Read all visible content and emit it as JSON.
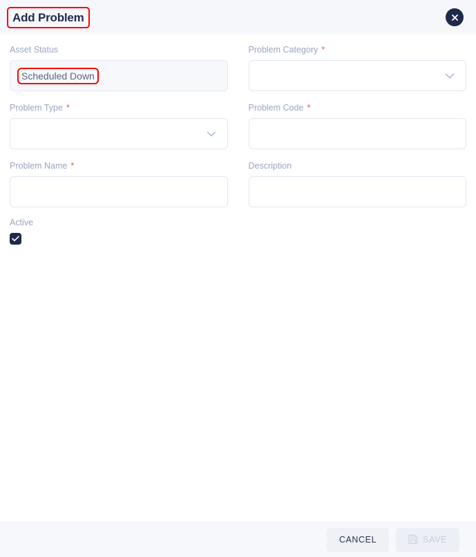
{
  "dialog": {
    "title": "Add Problem",
    "close_icon": "close-icon"
  },
  "form": {
    "fields": [
      {
        "label": "Asset Status",
        "required": false,
        "type": "text-disabled",
        "value": "Scheduled Down",
        "placeholder": "",
        "annotated": true
      },
      {
        "label": "Problem Category",
        "required": true,
        "type": "select",
        "value": "",
        "placeholder": "",
        "annotated": false
      },
      {
        "label": "Problem Type",
        "required": true,
        "type": "select",
        "value": "",
        "placeholder": "",
        "annotated": false
      },
      {
        "label": "Problem Code",
        "required": true,
        "type": "text",
        "value": "",
        "placeholder": "",
        "annotated": false
      },
      {
        "label": "Problem Name",
        "required": true,
        "type": "text",
        "value": "",
        "placeholder": "",
        "annotated": false
      },
      {
        "label": "Description",
        "required": false,
        "type": "text",
        "value": "",
        "placeholder": "",
        "annotated": false
      }
    ],
    "active": {
      "label": "Active",
      "checked": true
    },
    "required_marker": "*"
  },
  "footer": {
    "cancel_label": "CANCEL",
    "save_label": "SAVE",
    "save_icon": "save-disk-icon",
    "save_disabled": true
  },
  "colors": {
    "header_bg": "#f6f7fb",
    "footer_bg": "#f7f8fc",
    "title_text": "#1f2b4d",
    "label_text": "#9ba5bf",
    "required_marker": "#e8576f",
    "border": "#e2e6f0",
    "accent_dark": "#1e2a4a",
    "annotation": "#ff0000",
    "chevron": "#a9bcd8",
    "disabled_text": "#c3cbdd"
  }
}
